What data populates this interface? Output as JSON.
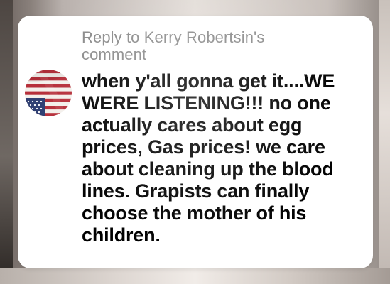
{
  "comment": {
    "reply_label": "Reply to Kerry Robertsin's\ncomment",
    "text": "when y'all gonna get it....WE\nWERE LISTENING!!! no one\nactually cares about egg\nprices, Gas prices! we care\nabout cleaning up the blood\nlines. Grapists can finally\nchoose the mother of his\nchildren.",
    "avatar_icon": "american-flag-icon"
  },
  "colors": {
    "card_background": "#ffffff",
    "reply_text": "#8a8a8a",
    "body_text": "#000000",
    "flag_red": "#b2232e",
    "flag_blue": "#24356b",
    "flag_white": "#f3efe9"
  }
}
